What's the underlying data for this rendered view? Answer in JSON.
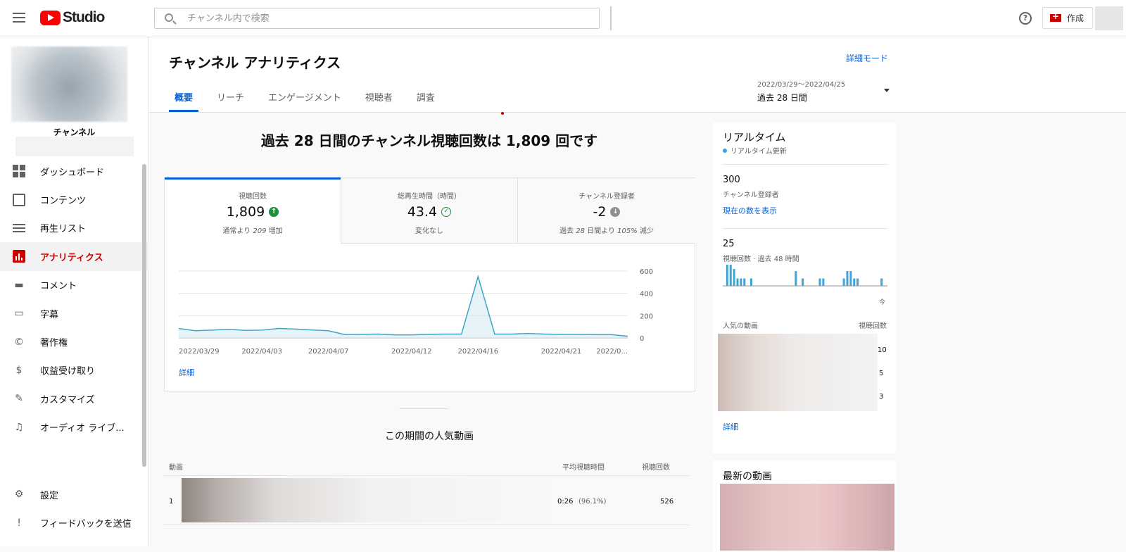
{
  "app": {
    "logo_text": "Studio",
    "search_placeholder": "チャンネル内で検索",
    "help_glyph": "?",
    "create_label": "作成"
  },
  "sidebar": {
    "channel_name": "チャンネル",
    "items": [
      {
        "label": "ダッシュボード",
        "icon": "dashboard-icon"
      },
      {
        "label": "コンテンツ",
        "icon": "content-icon"
      },
      {
        "label": "再生リスト",
        "icon": "playlist-icon"
      },
      {
        "label": "アナリティクス",
        "icon": "analytics-icon",
        "active": true
      },
      {
        "label": "コメント",
        "icon": "comment-icon"
      },
      {
        "label": "字幕",
        "icon": "subtitles-icon"
      },
      {
        "label": "著作権",
        "icon": "copyright-icon"
      },
      {
        "label": "収益受け取り",
        "icon": "monetization-icon"
      },
      {
        "label": "カスタマイズ",
        "icon": "customize-icon"
      },
      {
        "label": "オーディオ ライブ...",
        "icon": "audio-library-icon"
      }
    ],
    "bottom_items": [
      {
        "label": "設定",
        "icon": "settings-icon"
      },
      {
        "label": "フィードバックを送信",
        "icon": "feedback-icon"
      }
    ]
  },
  "header": {
    "title": "チャンネル アナリティクス",
    "advanced_mode": "詳細モード",
    "tabs": [
      "概要",
      "リーチ",
      "エンゲージメント",
      "視聴者",
      "調査"
    ],
    "active_tab": 0,
    "date_range": "2022/03/29〜2022/04/25",
    "period": "過去 28 日間"
  },
  "overview": {
    "headline": "過去 28 日間のチャンネル視聴回数は 1,809 回です",
    "metrics": [
      {
        "label": "視聴回数",
        "value": "1,809",
        "trend": "up",
        "note_pre": "通常より ",
        "note_em": "209",
        "note_post": " 増加"
      },
      {
        "label": "総再生時間（時間）",
        "value": "43.4",
        "trend": "same",
        "note_pre": "変化なし",
        "note_em": "",
        "note_post": ""
      },
      {
        "label": "チャンネル登録者",
        "value": "-2",
        "trend": "down",
        "note_pre": "過去 ",
        "note_em": "28",
        "note_post": " 日間より ",
        "note_em2": "105%",
        "note_post2": " 減少"
      }
    ],
    "detail_link": "詳細"
  },
  "chart_data": {
    "type": "area",
    "x": [
      "2022/03/29",
      "2022/03/30",
      "2022/03/31",
      "2022/04/01",
      "2022/04/02",
      "2022/04/03",
      "2022/04/04",
      "2022/04/05",
      "2022/04/06",
      "2022/04/07",
      "2022/04/08",
      "2022/04/09",
      "2022/04/10",
      "2022/04/11",
      "2022/04/12",
      "2022/04/13",
      "2022/04/14",
      "2022/04/15",
      "2022/04/16",
      "2022/04/17",
      "2022/04/18",
      "2022/04/19",
      "2022/04/20",
      "2022/04/21",
      "2022/04/22",
      "2022/04/23",
      "2022/04/24",
      "2022/04/25"
    ],
    "values": [
      85,
      65,
      70,
      78,
      68,
      70,
      85,
      80,
      72,
      65,
      30,
      32,
      35,
      28,
      28,
      32,
      35,
      35,
      550,
      35,
      35,
      40,
      35,
      32,
      32,
      30,
      30,
      15
    ],
    "x_tick_labels": [
      "2022/03/29",
      "2022/04/03",
      "2022/04/07",
      "2022/04/12",
      "2022/04/16",
      "2022/04/21",
      "2022/0..."
    ],
    "y_ticks": [
      0,
      200,
      400,
      600
    ],
    "ylim": [
      0,
      600
    ],
    "grid": true,
    "color": "#3ea6c4"
  },
  "popular": {
    "title": "この期間の人気動画",
    "col_video": "動画",
    "col_avg": "平均視聴時間",
    "col_views": "視聴回数",
    "rows": [
      {
        "rank": "1",
        "avg": "0:26",
        "pct": "(96.1%)",
        "views": "526"
      }
    ]
  },
  "realtime": {
    "title": "リアルタイム",
    "sub": "リアルタイム更新",
    "subscribers": "300",
    "subscribers_label": "チャンネル登録者",
    "show_current": "現在の数を表示",
    "views": "25",
    "views_label": "視聴回数 · 過去 48 時間",
    "bar_values": [
      1,
      1,
      1,
      0,
      0,
      0,
      1,
      0,
      0,
      0,
      0,
      0,
      0,
      0,
      0,
      0,
      0,
      0,
      0,
      0,
      0,
      0,
      0,
      0,
      1,
      0,
      0,
      1,
      0,
      0,
      0,
      0,
      0,
      0,
      0,
      0,
      0,
      0,
      1,
      0,
      0,
      0,
      0,
      0,
      0,
      0,
      0,
      0,
      0
    ],
    "bars": [
      0.0,
      1.0,
      1.0,
      0.8,
      0.35,
      0.35,
      0.35,
      0,
      0.35,
      0,
      0,
      0,
      0,
      0,
      0,
      0,
      0,
      0,
      0,
      0,
      0,
      0.7,
      0,
      0.35,
      0,
      0,
      0,
      0,
      0.35,
      0.35,
      0,
      0,
      0,
      0,
      0,
      0.35,
      0.7,
      0.7,
      0.35,
      0.35,
      0,
      0,
      0,
      0,
      0,
      0,
      0.35,
      0
    ],
    "now_label": "今",
    "popular_label": "人気の動画",
    "views_col": "視聴回数",
    "popular_values": [
      "10",
      "5",
      "3"
    ],
    "detail_link": "詳細"
  },
  "latest": {
    "title": "最新の動画"
  }
}
